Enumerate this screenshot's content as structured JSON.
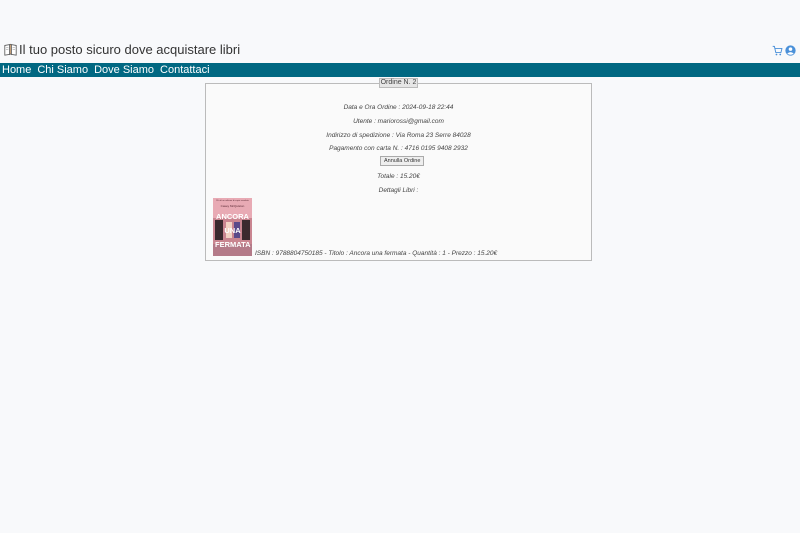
{
  "header": {
    "title": "Il tuo posto sicuro dove acquistare libri",
    "logo_icon": "book-icon",
    "cart_icon": "cart-icon",
    "user_icon": "user-icon",
    "accent": "#4a90d9"
  },
  "nav": {
    "background": "#016882",
    "items": [
      "Home",
      "Chi Siamo",
      "Dove Siamo",
      "Contattaci"
    ]
  },
  "order": {
    "legend": "Ordine N. 2",
    "date_line": "Data e Ora Ordine : 2024-09-18 22:44",
    "user_line": "Utente : mariorossi@gmail.com",
    "address_line": "Indirizzo di spedizione : Via Roma 23 Serre 84028",
    "payment_line": "Pagamento con carta N. : 4716 0195 9408 2932",
    "cancel_label": "Annulla Ordine",
    "total_line": "Totale : 15.20€",
    "details_label": "Dettagli Libri :",
    "books": [
      {
        "line": "ISBN : 9788804750185 - Titolo : Ancora una fermata - Quantità : 1 - Prezzo : 15.20€",
        "cover_title": "ANCORA UNA FERMATA",
        "cover_author": "Casey McQuiston",
        "cover_tagline": "Più di un milione di copie vendute"
      }
    ]
  }
}
